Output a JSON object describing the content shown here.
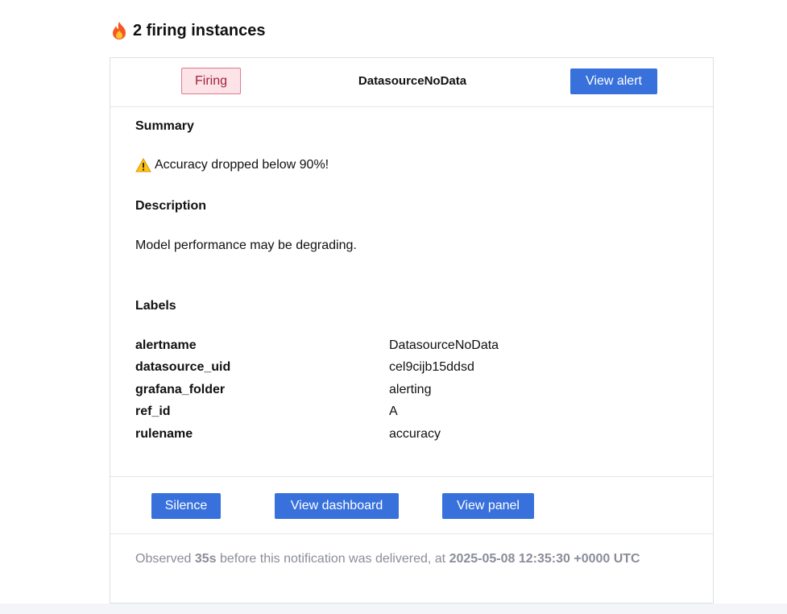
{
  "heading": {
    "icon": "fire-icon",
    "text": "2 firing instances"
  },
  "alert": {
    "status_badge": "Firing",
    "name": "DatasourceNoData",
    "view_alert_label": "View alert",
    "summary_title": "Summary",
    "summary_icon": "warning-icon",
    "summary_text": "Accuracy dropped below 90%!",
    "description_title": "Description",
    "description_text": "Model performance may be degrading.",
    "labels_title": "Labels",
    "labels": [
      {
        "key": "alertname",
        "value": "DatasourceNoData"
      },
      {
        "key": "datasource_uid",
        "value": "cel9cijb15ddsd"
      },
      {
        "key": "grafana_folder",
        "value": "alerting"
      },
      {
        "key": "ref_id",
        "value": "A"
      },
      {
        "key": "rulename",
        "value": "accuracy"
      }
    ]
  },
  "actions": {
    "silence_label": "Silence",
    "view_dashboard_label": "View dashboard",
    "view_panel_label": "View panel"
  },
  "footer": {
    "prefix": "Observed ",
    "duration": "35s",
    "middle": " before this notification was delivered, at ",
    "timestamp": "2025-05-08 12:35:30 +0000 UTC"
  },
  "colors": {
    "primary_button": "#3871dc",
    "firing_badge_bg": "#fbe3e7",
    "firing_badge_border": "#e07a8c",
    "firing_badge_text": "#a3223a",
    "muted_text": "#8a8d99"
  }
}
